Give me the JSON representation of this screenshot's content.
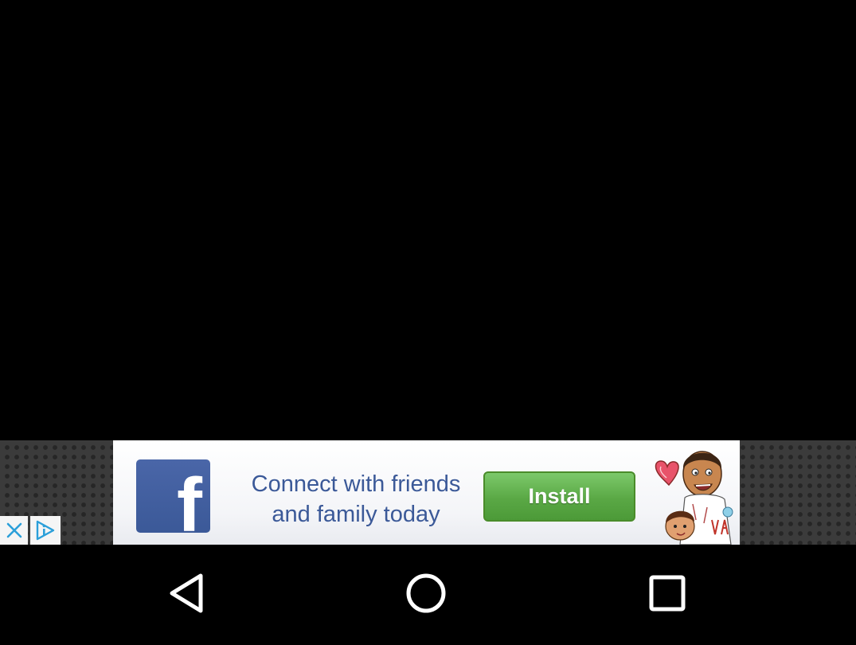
{
  "ad": {
    "close_icon": "close-icon",
    "adchoices_icon": "adchoices-icon",
    "logo_icon": "facebook-logo-icon",
    "logo_letter": "f",
    "line1": "Connect with friends",
    "line2": "and family today",
    "install_label": "Install",
    "colors": {
      "facebook_blue": "#3b5998",
      "install_green": "#5aa845",
      "adchoices_blue": "#2b9fd9"
    }
  },
  "nav": {
    "back_icon": "back-triangle-icon",
    "home_icon": "home-circle-icon",
    "recents_icon": "recents-square-icon"
  }
}
